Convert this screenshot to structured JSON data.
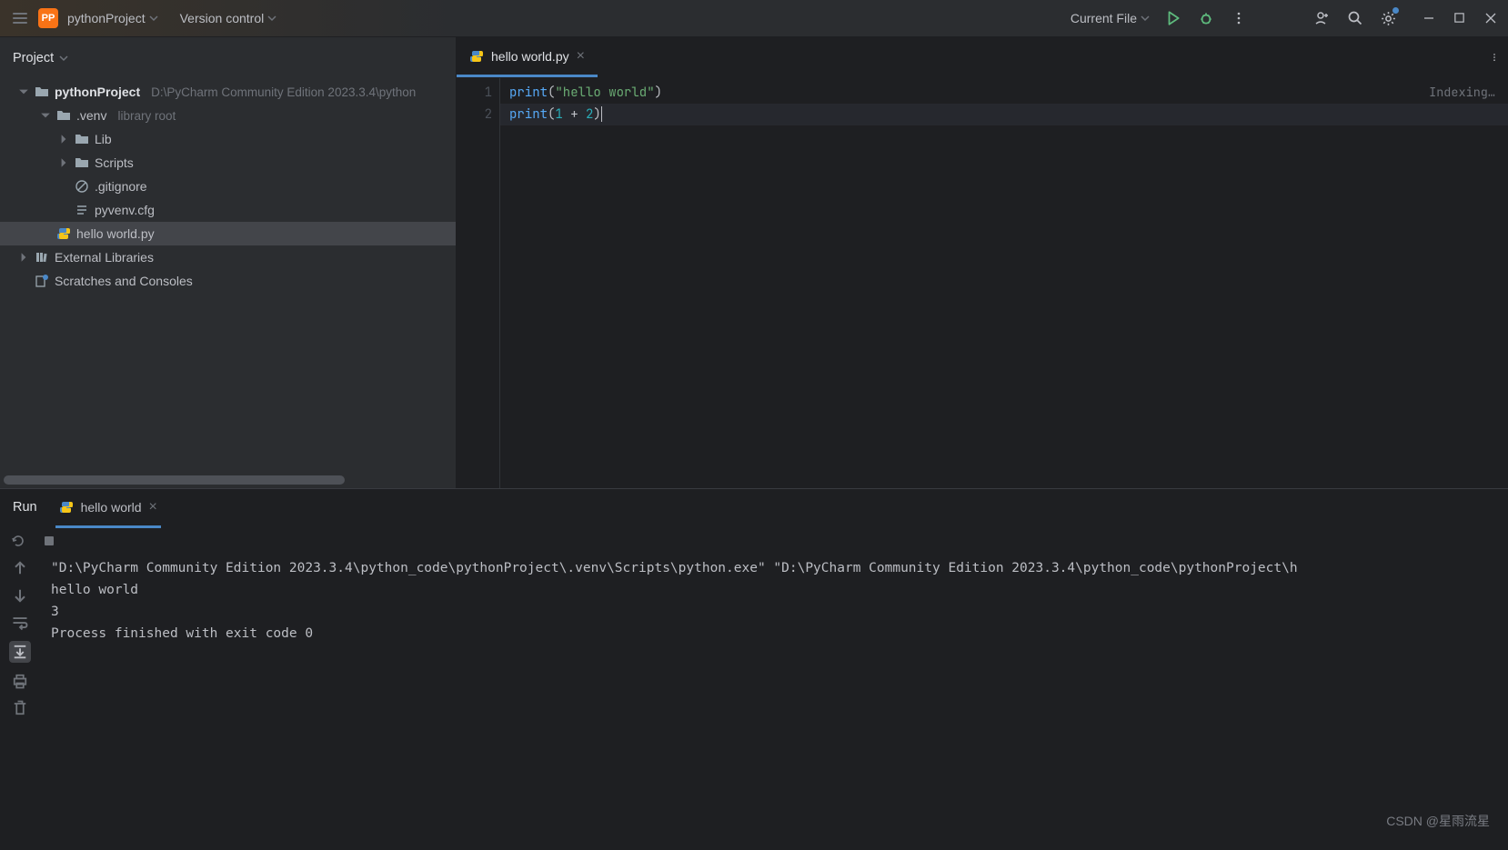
{
  "titlebar": {
    "badge": "PP",
    "project_name": "pythonProject",
    "version_control": "Version control",
    "run_config": "Current File"
  },
  "project_panel": {
    "title": "Project",
    "root_name": "pythonProject",
    "root_path": "D:\\PyCharm Community Edition 2023.3.4\\python",
    "venv": ".venv",
    "venv_hint": "library root",
    "lib": "Lib",
    "scripts": "Scripts",
    "gitignore": ".gitignore",
    "pyvenv": "pyvenv.cfg",
    "hello": "hello world.py",
    "ext_libs": "External Libraries",
    "scratches": "Scratches and Consoles"
  },
  "editor": {
    "tab_name": "hello world.py",
    "indexing": "Indexing…",
    "line1_fn": "print",
    "line1_str": "\"hello world\"",
    "line2_fn": "print",
    "line2_n1": "1",
    "line2_op": " + ",
    "line2_n2": "2",
    "ln1": "1",
    "ln2": "2"
  },
  "run": {
    "title": "Run",
    "tab_name": "hello world",
    "cmd": "\"D:\\PyCharm Community Edition 2023.3.4\\python_code\\pythonProject\\.venv\\Scripts\\python.exe\" \"D:\\PyCharm Community Edition 2023.3.4\\python_code\\pythonProject\\h",
    "out1": "hello world",
    "out2": "3",
    "blank": "",
    "exit": "Process finished with exit code 0"
  },
  "watermark": "CSDN @星雨流星"
}
